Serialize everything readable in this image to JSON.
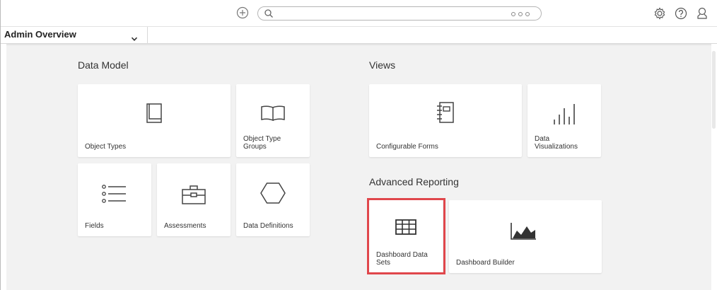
{
  "topbar": {
    "add_icon": "plus-circle-icon",
    "search": {
      "value": "",
      "icon": "search-icon",
      "more_icon": "more-dots-icon"
    },
    "icons": [
      "gear-icon",
      "help-icon",
      "user-icon"
    ]
  },
  "nav": {
    "selected_view": "Admin Overview"
  },
  "sections": {
    "data_model": "Data Model",
    "views": "Views",
    "advanced_reporting": "Advanced Reporting"
  },
  "tiles": {
    "object_types": "Object Types",
    "object_type_groups": "Object Type\nGroups",
    "fields": "Fields",
    "assessments": "Assessments",
    "data_definitions": "Data Definitions",
    "configurable_forms": "Configurable Forms",
    "data_visualizations": "Data\nVisualizations",
    "dashboard_data_sets": "Dashboard Data\nSets",
    "dashboard_builder": "Dashboard Builder"
  },
  "colors": {
    "highlight": "#e0474c",
    "background": "#f2f2f2",
    "icon": "#444444"
  }
}
